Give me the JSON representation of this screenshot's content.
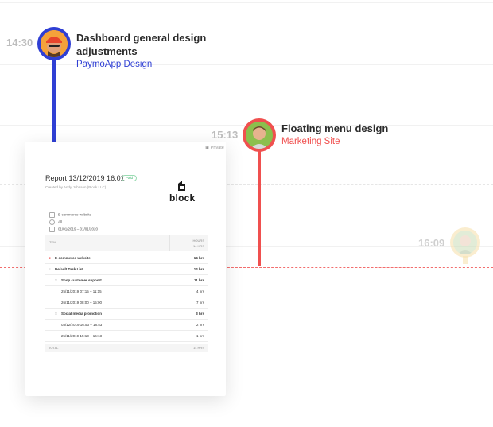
{
  "timeline": {
    "times": [
      "14:30",
      "15:13",
      "16:09"
    ]
  },
  "events": [
    {
      "title_line1": "Dashboard general design",
      "title_line2": "adjustments",
      "project": "PaymoApp Design",
      "color": "#2f3fd4"
    },
    {
      "title_line1": "Floating menu design",
      "project": "Marketing Site",
      "color": "#f0504f"
    }
  ],
  "report": {
    "private_label": "Private",
    "title": "Report 13/12/2019 16:01",
    "badge": "Paid",
    "created_by": "Created by Andy Johnson (Block LLC)",
    "logo_text": "block",
    "meta": [
      "E-commerce website",
      "All",
      "01/01/2019 – 01/01/2020"
    ],
    "table_header": {
      "item": "ITEM",
      "hours": "HOURS",
      "hours_sub": "14 HRS"
    },
    "rows": [
      {
        "label": "E-commerce website",
        "hours": "14 hrs",
        "bold": true
      },
      {
        "label": "Default Task List",
        "hours": "14 hrs",
        "bold": true
      },
      {
        "label": "Shop customer support",
        "hours": "11 hrs",
        "bold": true
      },
      {
        "label": "25/11/2019 07:15 – 11:15",
        "hours": "4 hrs",
        "bold": false
      },
      {
        "label": "26/11/2019 08:00 – 15:00",
        "hours": "7 hrs",
        "bold": false
      },
      {
        "label": "Social media promotion",
        "hours": "3 hrs",
        "bold": true
      },
      {
        "label": "03/12/2019 16:53 – 18:53",
        "hours": "2 hrs",
        "bold": false
      },
      {
        "label": "25/11/2019 15:13 – 16:13",
        "hours": "1 hrs",
        "bold": false
      }
    ],
    "total_label": "TOTAL",
    "total_value": "14 HRS"
  }
}
